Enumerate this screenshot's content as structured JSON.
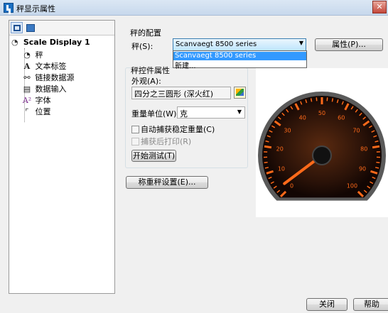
{
  "window": {
    "title": "秤显示属性",
    "close_glyph": "✕"
  },
  "tree": {
    "root_label": "Scale Display 1",
    "items": [
      {
        "label": "秤",
        "icon": "gauge-icon",
        "glyph": "◔"
      },
      {
        "label": "文本标签",
        "icon": "text-label-icon",
        "glyph": "A"
      },
      {
        "label": "链接数据源",
        "icon": "link-icon",
        "glyph": "⚯"
      },
      {
        "label": "数据输入",
        "icon": "keyboard-icon",
        "glyph": "▤"
      },
      {
        "label": "字体",
        "icon": "font-icon",
        "glyph": "A²"
      },
      {
        "label": "位置",
        "icon": "position-icon",
        "glyph": "⌜"
      }
    ]
  },
  "scale_config": {
    "group_label": "秤的配置",
    "scale_label": "秤(S):",
    "selected": "Scanvaegt 8500 series",
    "dropdown_options": [
      "Scanvaegt 8500 series",
      "新建..."
    ],
    "properties_button": "属性(P)..."
  },
  "control_props": {
    "group_label": "秤控件属性",
    "appearance_label": "外观(A):",
    "appearance_value": "四分之三圆形 (深火红)",
    "unit_label": "重量单位(W):",
    "unit_value": "克",
    "auto_capture_label": "自动捕获稳定重量(C)",
    "print_after_capture_label": "捕获后打印(R)",
    "start_test_button": "开始测试(T)"
  },
  "reset_button": "称重秤设置(E)...",
  "footer": {
    "close_button": "关闭",
    "help_button": "帮助"
  },
  "gauge": {
    "ticks": [
      "0",
      "10",
      "20",
      "30",
      "40",
      "50",
      "60",
      "70",
      "80",
      "90",
      "100"
    ],
    "value": 3,
    "colors": {
      "accent": "#ff6a1a",
      "face": "#2a1208",
      "bezel": "#5a5a5a"
    }
  }
}
